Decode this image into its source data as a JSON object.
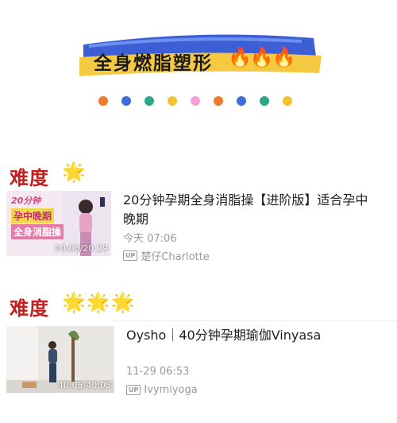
{
  "banner": {
    "title": "全身燃脂塑形",
    "fire_icons": "🔥🔥🔥"
  },
  "dots": [
    "#f07a2a",
    "#3b6fd4",
    "#2aa88a",
    "#f2c232",
    "#f3a2d6",
    "#f07a2a",
    "#3b6fd4",
    "#2aa88a",
    "#f2c232"
  ],
  "sections": [
    {
      "heading": "难度",
      "stars": "🌟",
      "video": {
        "title": "20分钟孕期全身消脂操【进阶版】适合孕中晚期",
        "time": "今天  07:06",
        "up_badge": "UP",
        "uploader": "楚仔Charlotte",
        "duration": "00:06/20:29",
        "thumb_text_top": "20分钟",
        "thumb_text_mid": "孕中晚期",
        "thumb_text_bottom": "全身消脂操"
      }
    },
    {
      "heading": "难度",
      "stars": "🌟🌟🌟",
      "video": {
        "title": "Oysho｜40分钟孕期瑜伽Vinyasa",
        "time": "11-29  06:53",
        "up_badge": "UP",
        "uploader": "Ivymiyoga",
        "duration": "40:05/40:05"
      }
    }
  ]
}
